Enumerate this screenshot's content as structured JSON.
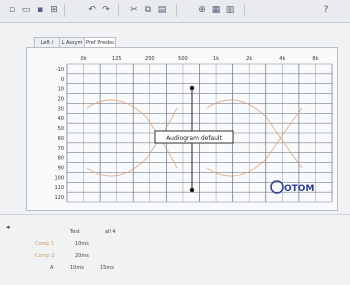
{
  "toolbar": {
    "icons": [
      "new-icon",
      "open-icon",
      "save-icon",
      "print-icon",
      "undo-icon",
      "redo-icon",
      "cut-icon",
      "copy-icon",
      "paste-icon",
      "zoom-icon",
      "grid-icon",
      "chart-icon",
      "help-icon"
    ]
  },
  "tabs": [
    {
      "label": "Left / Last",
      "active": false
    },
    {
      "label": "L Assym",
      "active": false
    },
    {
      "label": "Pref Presbo I",
      "active": true
    }
  ],
  "audiogram": {
    "x_labels": [
      "0k",
      "125",
      "250",
      "500",
      "1k",
      "2k",
      "4k",
      "8k"
    ],
    "y_labels": [
      "-10",
      "0",
      "10",
      "20",
      "30",
      "40",
      "50",
      "60",
      "70",
      "80",
      "90",
      "100",
      "110",
      "120"
    ],
    "popup_label": "Audiogram default",
    "logo_text": "OTOM",
    "colors": {
      "curve": "#d9a07c",
      "grid": "#7a808c",
      "logo": "#2c3f8c"
    }
  },
  "bottom": {
    "header_col1": "Test",
    "header_col2": "all 4",
    "row1_label": "Comp 1",
    "row1_value": "10ms",
    "row2_label": "Comp 2",
    "row2_value": "20ms",
    "row3_label": "A",
    "row3_value1": "10ms",
    "row3_value2": "15ms"
  }
}
